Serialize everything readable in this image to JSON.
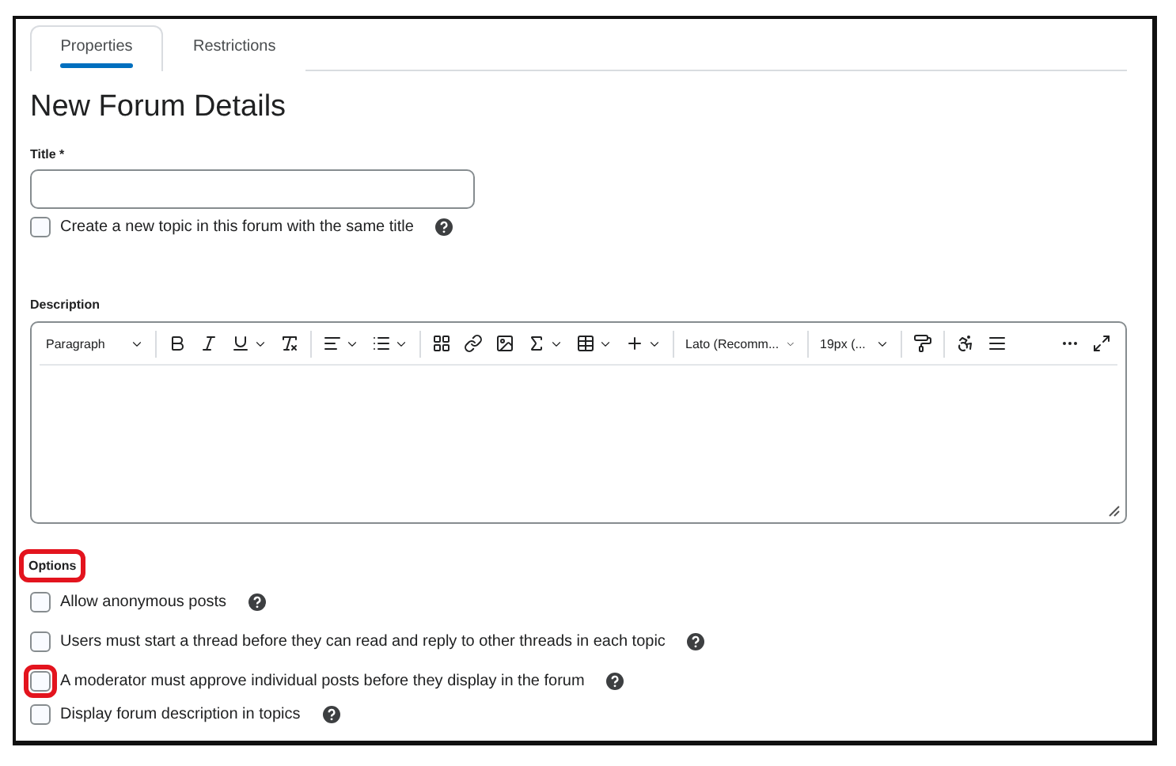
{
  "tabs": [
    {
      "label": "Properties",
      "selected": true
    },
    {
      "label": "Restrictions",
      "selected": false
    }
  ],
  "heading": "New Forum Details",
  "title_field": {
    "label": "Title",
    "required_mark": "*"
  },
  "same_title_option": {
    "label": "Create a new topic in this forum with the same title",
    "checked": false
  },
  "description": {
    "label": "Description",
    "toolbar": {
      "block_format": "Paragraph",
      "font": "Lato (Recomm...",
      "size": "19px (..."
    }
  },
  "options": {
    "heading": {
      "label": "Options",
      "highlighted": true
    },
    "items": [
      {
        "label": "Allow anonymous posts",
        "checked": false,
        "highlighted": false
      },
      {
        "label": "Users must start a thread before they can read and reply to other threads in each topic",
        "checked": false,
        "highlighted": false
      },
      {
        "label": "A moderator must approve individual posts before they display in the forum",
        "checked": false,
        "highlighted": true
      },
      {
        "label": "Display forum description in topics",
        "checked": false,
        "highlighted": false
      }
    ]
  }
}
